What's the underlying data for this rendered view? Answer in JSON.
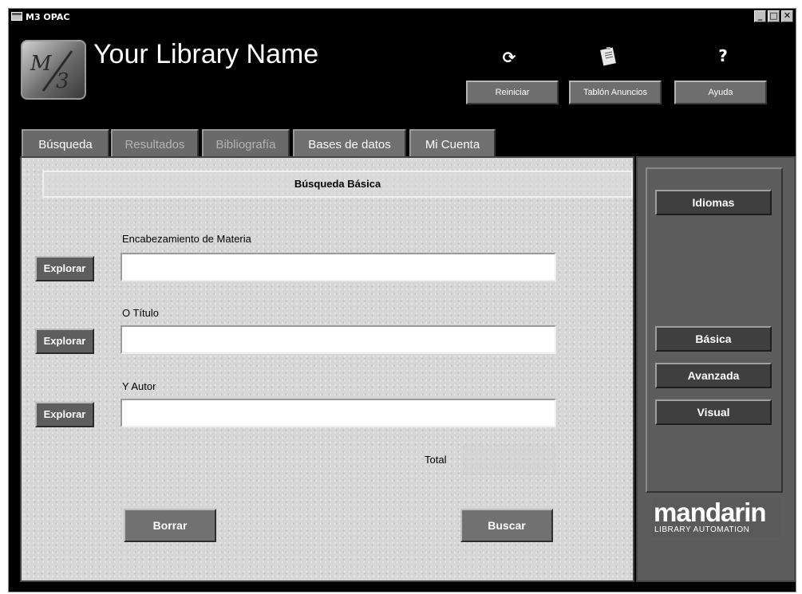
{
  "window": {
    "title": "M3 OPAC",
    "buttons": {
      "minimize": "_",
      "maximize": "□",
      "close": "✕"
    }
  },
  "header": {
    "library_name": "Your Library Name",
    "logo_text": "M3",
    "reset_label": "Reiniciar",
    "bulletin_label": "Tablón Anuncios",
    "help_label": "Ayuda",
    "help_glyph": "?",
    "reset_glyph": "⟳"
  },
  "tabs": [
    {
      "label": "Búsqueda"
    },
    {
      "label": "Resultados"
    },
    {
      "label": "Bibliografía"
    },
    {
      "label": "Bases de datos"
    },
    {
      "label": "Mi Cuenta"
    }
  ],
  "search": {
    "title": "Búsqueda Básica",
    "fields": [
      {
        "label": "Encabezamiento de Materia",
        "value": "",
        "browse_label": "Explorar"
      },
      {
        "label": "O Título",
        "value": "",
        "browse_label": "Explorar"
      },
      {
        "label": "Y Autor",
        "value": "",
        "browse_label": "Explorar"
      }
    ],
    "total_label": "Total",
    "total_value": "",
    "clear_label": "Borrar",
    "search_label": "Buscar"
  },
  "sidebar": {
    "languages_label": "Idiomas",
    "basic_label": "Básica",
    "advanced_label": "Avanzada",
    "visual_label": "Visual",
    "brand_name": "mandarin",
    "brand_tagline": "LIBRARY AUTOMATION"
  }
}
